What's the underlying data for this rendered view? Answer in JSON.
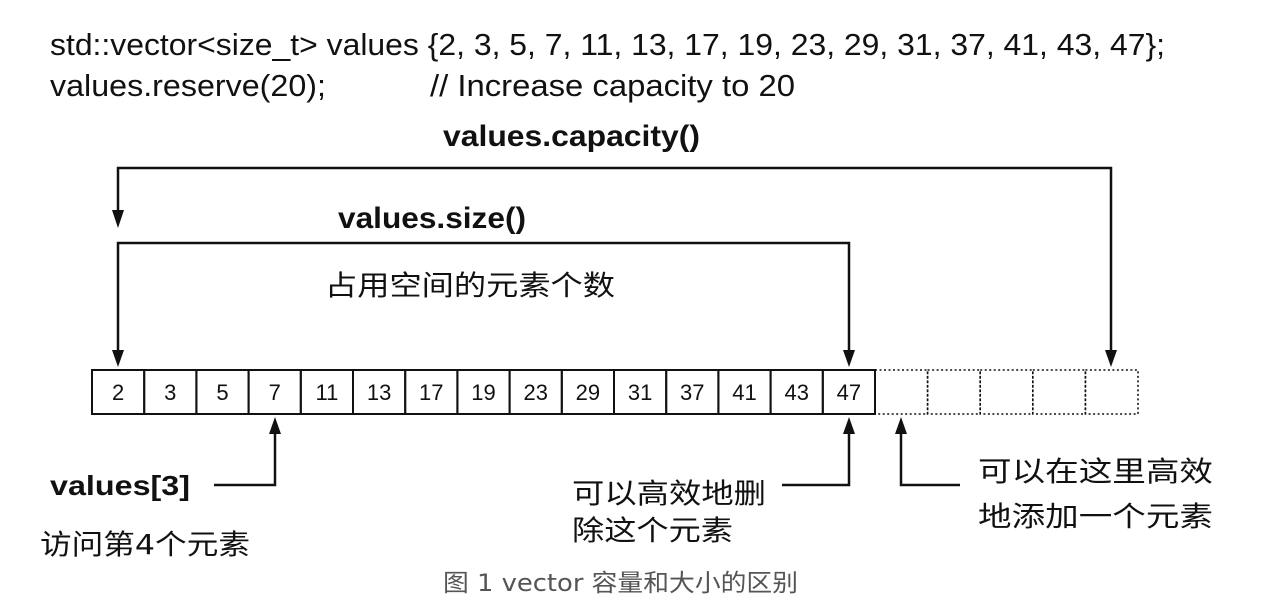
{
  "code": {
    "declaration": "std::vector<size_t> values {2, 3, 5, 7, 11, 13, 17, 19, 23, 29, 31, 37, 41, 43, 47};",
    "reserve_call": "values.reserve(20);",
    "reserve_comment": "// Increase capacity to 20"
  },
  "labels": {
    "capacity": "values.capacity()",
    "size": "values.size()",
    "size_note": "占用空间的元素个数",
    "index_access": "values[3]",
    "index_note": "访问第4个元素",
    "delete_note_line1": "可以高效地删",
    "delete_note_line2": "除这个元素",
    "add_note_line1": "可以在这里高效",
    "add_note_line2": "地添加一个元素"
  },
  "vector": {
    "elements": [
      2,
      3,
      5,
      7,
      11,
      13,
      17,
      19,
      23,
      29,
      31,
      37,
      41,
      43,
      47
    ],
    "unused_capacity_slots": 5
  },
  "caption": "图 1 vector 容量和大小的区别",
  "colors": {
    "ink": "#111111",
    "caption": "#555555",
    "background": "#ffffff"
  }
}
